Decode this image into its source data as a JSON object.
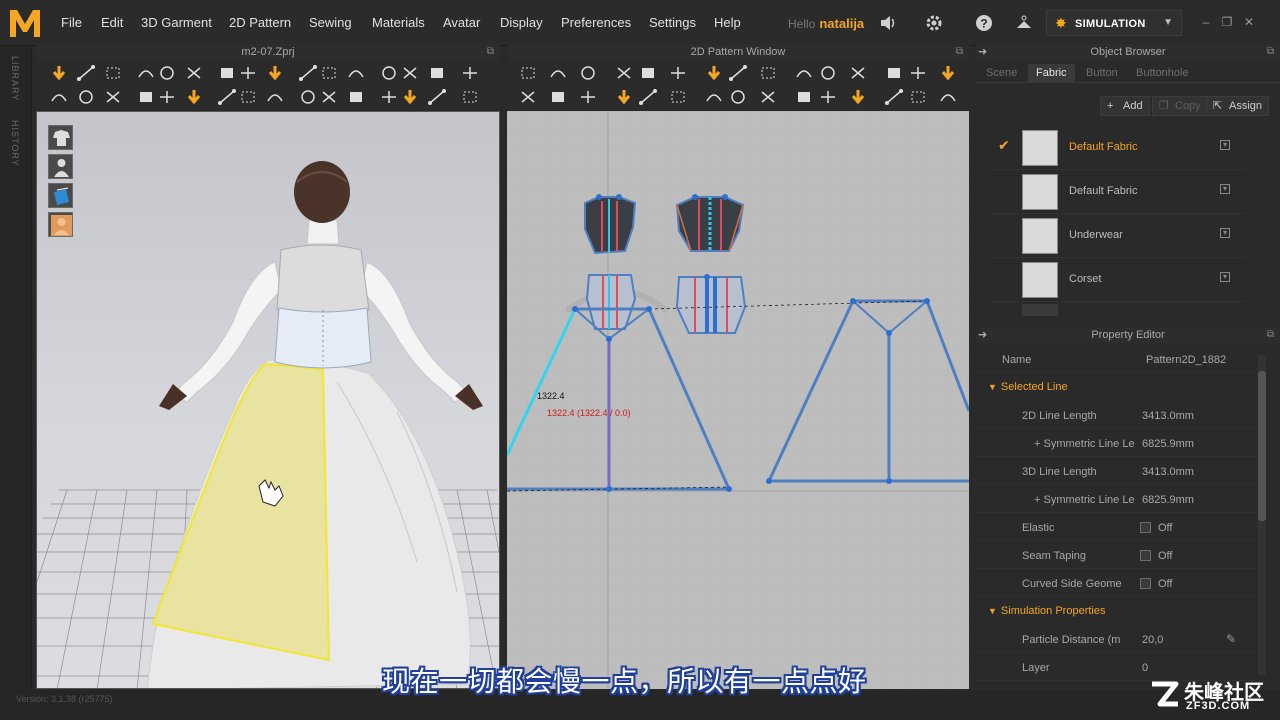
{
  "app": {
    "logo_letter": "M",
    "menu": [
      "File",
      "Edit",
      "3D Garment",
      "2D Pattern",
      "Sewing",
      "Materials",
      "Avatar",
      "Display",
      "Preferences",
      "Settings",
      "Help"
    ],
    "user_greeting": "Hello",
    "user_name": "natalija",
    "mode_label": "SIMULATION",
    "version": "Version: 3.1.38 (r25775)"
  },
  "left_tabs": [
    "LIBRARY",
    "HISTORY"
  ],
  "viewport3d": {
    "title": "m2-07.Zprj"
  },
  "pattern2d": {
    "title": "2D Pattern Window",
    "measure_label": "1322.4",
    "measure_detail": "1322.4 (1322.4 / 0.0)"
  },
  "object_browser": {
    "title": "Object Browser",
    "tabs": [
      "Scene",
      "Fabric",
      "Button",
      "Buttonhole"
    ],
    "active_tab": "Fabric",
    "actions": {
      "add": "Add",
      "copy": "Copy",
      "assign": "Assign"
    },
    "fabrics": [
      {
        "name": "Default Fabric",
        "selected": true
      },
      {
        "name": "Default Fabric",
        "selected": false
      },
      {
        "name": "Underwear",
        "selected": false
      },
      {
        "name": "Corset",
        "selected": false
      }
    ]
  },
  "property_editor": {
    "title": "Property Editor",
    "name_label": "Name",
    "name_value": "Pattern2D_1882",
    "selected_line_section": "Selected Line",
    "rows": [
      {
        "label": "2D Line Length",
        "value": "3413.0mm"
      },
      {
        "label": "+ Symmetric Line Le",
        "value": "6825.9mm"
      },
      {
        "label": "3D Line Length",
        "value": "3413.0mm"
      },
      {
        "label": "+ Symmetric Line Le",
        "value": "6825.9mm"
      }
    ],
    "toggles": [
      {
        "label": "Elastic",
        "value": "Off"
      },
      {
        "label": "Seam Taping",
        "value": "Off"
      },
      {
        "label": "Curved Side Geome",
        "value": "Off"
      }
    ],
    "simulation_section": "Simulation Properties",
    "sim_rows": [
      {
        "label": "Particle Distance (m",
        "value": "20,0"
      },
      {
        "label": "Layer",
        "value": "0"
      }
    ]
  },
  "subtitle": "现在一切都会慢一点，所以有一点点好",
  "watermark": {
    "cn": "朱峰社区",
    "en": "ZF3D.COM"
  },
  "colors": {
    "accent": "#f5a623",
    "pattern_line": "#4f7fc2",
    "selected_line": "#2fd6f2"
  }
}
